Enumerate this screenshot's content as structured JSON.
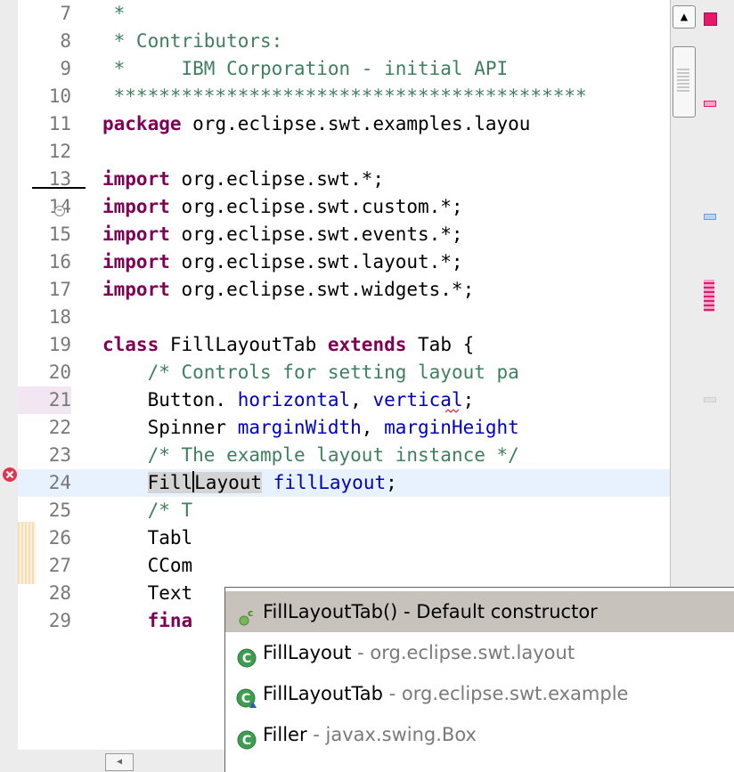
{
  "editor": {
    "lines": [
      {
        "num": "7",
        "parts": [
          {
            "t": " *",
            "c": "cm"
          }
        ]
      },
      {
        "num": "8",
        "parts": [
          {
            "t": " * Contributors:",
            "c": "cm"
          }
        ]
      },
      {
        "num": "9",
        "parts": [
          {
            "t": " *     IBM Corporation - initial API",
            "c": "cm"
          }
        ]
      },
      {
        "num": "10",
        "parts": [
          {
            "t": " ******************************************",
            "c": "cm"
          }
        ]
      },
      {
        "num": "11",
        "parts": [
          {
            "t": "package",
            "c": "kw"
          },
          {
            "t": " org.eclipse.swt.examples.layou"
          }
        ]
      },
      {
        "num": "12",
        "parts": []
      },
      {
        "num": "13",
        "parts": [
          {
            "t": "import",
            "c": "kw"
          },
          {
            "t": " org.eclipse.swt.*;"
          }
        ]
      },
      {
        "num": "14",
        "parts": [
          {
            "t": "import",
            "c": "kw"
          },
          {
            "t": " org.eclipse.swt.custom.*;"
          }
        ]
      },
      {
        "num": "15",
        "parts": [
          {
            "t": "import",
            "c": "kw"
          },
          {
            "t": " org.eclipse.swt.events.*;"
          }
        ]
      },
      {
        "num": "16",
        "parts": [
          {
            "t": "import",
            "c": "kw"
          },
          {
            "t": " org.eclipse.swt.layout.*;"
          }
        ]
      },
      {
        "num": "17",
        "parts": [
          {
            "t": "import",
            "c": "kw"
          },
          {
            "t": " org.eclipse.swt.widgets.*;"
          }
        ]
      },
      {
        "num": "18",
        "parts": []
      },
      {
        "num": "19",
        "parts": [
          {
            "t": "class",
            "c": "kw"
          },
          {
            "t": " FillLayoutTab "
          },
          {
            "t": "extends",
            "c": "kw"
          },
          {
            "t": " Tab {"
          }
        ]
      },
      {
        "num": "20",
        "parts": [
          {
            "t": "    "
          },
          {
            "t": "/* Controls for setting layout pa",
            "c": "cm"
          }
        ]
      },
      {
        "num": "21",
        "parts": [
          {
            "t": "    Button. "
          },
          {
            "t": "horizontal",
            "c": "fd"
          },
          {
            "t": ", "
          },
          {
            "t": "vertical",
            "c": "fd"
          },
          {
            "t": ";"
          }
        ]
      },
      {
        "num": "22",
        "parts": [
          {
            "t": "    Spinner "
          },
          {
            "t": "marginWidth",
            "c": "fd"
          },
          {
            "t": ", "
          },
          {
            "t": "marginHeight",
            "c": "fd"
          }
        ]
      },
      {
        "num": "23",
        "parts": [
          {
            "t": "    "
          },
          {
            "t": "/* The example layout instance */",
            "c": "cm"
          }
        ]
      },
      {
        "num": "24",
        "parts": [
          {
            "t": "    "
          },
          {
            "t": "FillLayout",
            "c": "occ"
          },
          {
            "t": " "
          },
          {
            "t": "fillLayout",
            "c": "fd"
          },
          {
            "t": ";"
          }
        ]
      },
      {
        "num": "25",
        "parts": [
          {
            "t": "    "
          },
          {
            "t": "/* T",
            "c": "cm"
          }
        ]
      },
      {
        "num": "26",
        "parts": [
          {
            "t": "    Tabl"
          }
        ]
      },
      {
        "num": "27",
        "parts": [
          {
            "t": "    CCom"
          }
        ]
      },
      {
        "num": "28",
        "parts": [
          {
            "t": "    Text"
          }
        ]
      },
      {
        "num": "29",
        "parts": [
          {
            "t": "    "
          },
          {
            "t": "fina",
            "c": "kw"
          }
        ]
      }
    ]
  },
  "completion": {
    "items": [
      {
        "label": "FillLayoutTab() - Default constructor",
        "qualifier": "",
        "icon": "constructor-icon",
        "selected": true
      },
      {
        "label": "FillLayout",
        "qualifier": " - org.eclipse.swt.layout",
        "icon": "class-icon",
        "selected": false
      },
      {
        "label": "FillLayoutTab",
        "qualifier": " - org.eclipse.swt.example",
        "icon": "default-class-icon",
        "selected": false
      },
      {
        "label": "Filler",
        "qualifier": " - javax.swing.Box",
        "icon": "class-icon",
        "selected": false
      }
    ]
  },
  "colors": {
    "keyword": "#7f0055",
    "comment": "#3f7f5f",
    "field": "#0000c0",
    "current_line": "#e8f2fe",
    "error": "#e0344a",
    "selection": "#c8c2bc"
  }
}
